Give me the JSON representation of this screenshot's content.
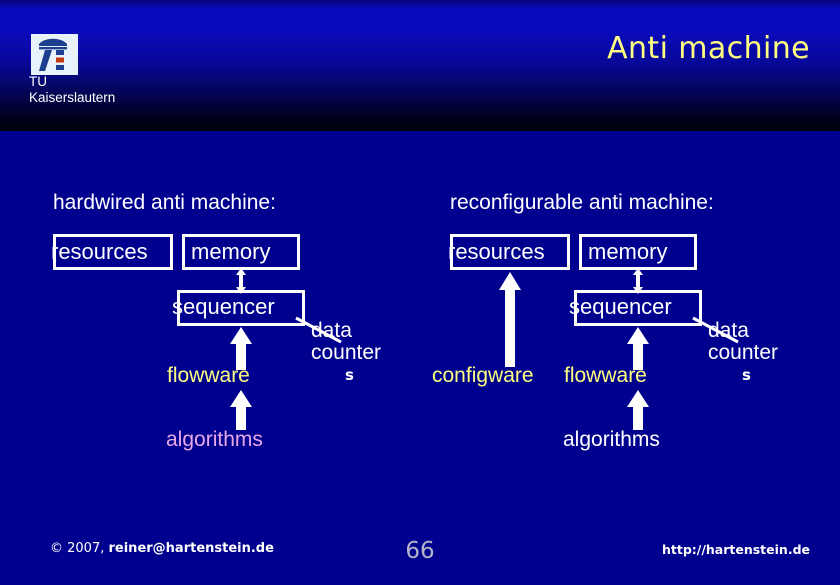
{
  "slide": {
    "title": "Anti machine",
    "title_color": "#ffff80",
    "background_color": "#00008f"
  },
  "logo": {
    "icon": "tu-kaiserslautern-lighthouse-logo",
    "label": "TU\nKaiserslautern"
  },
  "left_diagram": {
    "heading": "hardwired anti machine:",
    "boxes": {
      "resources": "resources",
      "memory": "memory",
      "sequencer": "sequencer"
    },
    "labels": {
      "flowware": "flowware",
      "algorithms": "algorithms",
      "data_counter": "data\ncounter",
      "data_counter_sub": "s"
    },
    "colors": {
      "flowware": "#ffff80",
      "algorithms": "#e8a8e8",
      "box_stroke": "#ffffff"
    }
  },
  "right_diagram": {
    "heading": "reconfigurable anti machine:",
    "boxes": {
      "resources": "resources",
      "memory": "memory",
      "sequencer": "sequencer"
    },
    "labels": {
      "configware": "configware",
      "flowware": "flowware",
      "algorithms": "algorithms",
      "data_counter": "data\ncounter",
      "data_counter_sub": "s"
    },
    "colors": {
      "configware": "#ffff80",
      "flowware": "#ffff80",
      "algorithms": "#ffffff",
      "box_stroke": "#ffffff"
    }
  },
  "footer": {
    "copyright_symbol": "©",
    "year": "2007,",
    "email": "reiner@hartenstein.de",
    "page_number": "66",
    "url": "http://hartenstein.de"
  }
}
